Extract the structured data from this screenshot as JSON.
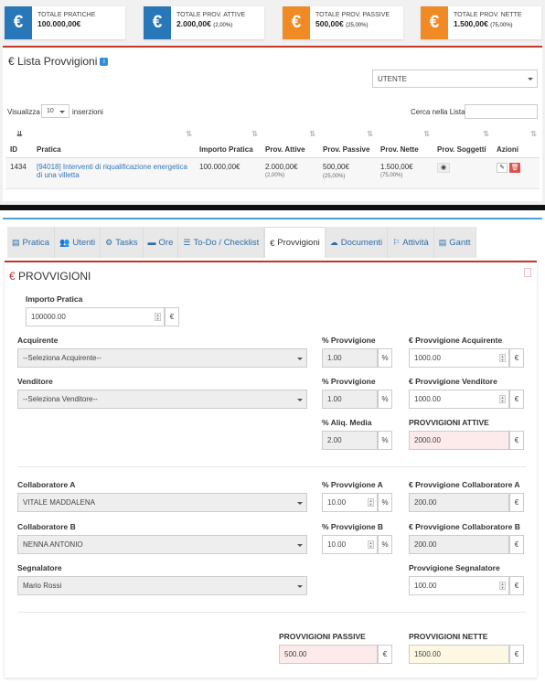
{
  "summary_cards": [
    {
      "label": "TOTALE PRATICHE",
      "value": "100.000,00€",
      "pct": "",
      "color": "#2877b9"
    },
    {
      "label": "TOTALE PROV. ATTIVE",
      "value": "2.000,00€",
      "pct": "(2,00%)",
      "color": "#2877b9"
    },
    {
      "label": "TOTALE PROV. PASSIVE",
      "value": "500,00€",
      "pct": "(25,00%)",
      "color": "#f08a24"
    },
    {
      "label": "TOTALE PROV. NETTE",
      "value": "1.500,00€",
      "pct": "(75,00%)",
      "color": "#f08a24"
    }
  ],
  "card_icon": "€",
  "lista": {
    "title": "Lista Provvigioni",
    "info_icon": "i",
    "user_select": "UTENTE",
    "show_prefix": "Visualizza",
    "show_value": "10",
    "show_suffix": "inserzioni",
    "search_label": "Cerca nella Lista:",
    "columns": [
      "ID",
      "Pratica",
      "Importo Pratica",
      "Prov. Attive",
      "Prov. Passive",
      "Prov. Nette",
      "Prov. Soggetti",
      "Azioni"
    ],
    "rows": [
      {
        "id": "1434",
        "pratica": "[94018] Interventi di riqualificazione energetica di una villetta",
        "importo": "100.000,00€",
        "attive": "2.000,00€",
        "attive_pct": "(2,00%)",
        "passive": "500,00€",
        "passive_pct": "(25,00%)",
        "nette": "1.500,00€",
        "nette_pct": "(75,00%)"
      }
    ]
  },
  "tabs": [
    {
      "label": "Pratica",
      "icon": "▤"
    },
    {
      "label": "Utenti",
      "icon": "👥"
    },
    {
      "label": "Tasks",
      "icon": "⚙"
    },
    {
      "label": "Ore",
      "icon": "▬"
    },
    {
      "label": "To-Do / Checklist",
      "icon": "☰"
    },
    {
      "label": "Provvigioni",
      "icon": "€"
    },
    {
      "label": "Documenti",
      "icon": "☁"
    },
    {
      "label": "Attività",
      "icon": "⚐"
    },
    {
      "label": "Gantt",
      "icon": "▤"
    }
  ],
  "provvigioni": {
    "title": "PROVVIGIONI",
    "importo_label": "Importo Pratica",
    "importo_value": "100000.00",
    "euro": "€",
    "pct": "%",
    "acquirente_label": "Acquirente",
    "acquirente_value": "--Seleziona Acquirente--",
    "pct_prov_label": "% Provvigione",
    "pct_acq_value": "1.00",
    "prov_acq_label": "€ Provvigione Acquirente",
    "prov_acq_value": "1000.00",
    "venditore_label": "Venditore",
    "venditore_value": "--Seleziona Venditore--",
    "pct_vend_value": "1.00",
    "prov_vend_label": "€ Provvigione Venditore",
    "prov_vend_value": "1000.00",
    "aliq_label": "% Aliq. Media",
    "aliq_value": "2.00",
    "attive_label": "PROVVIGIONI ATTIVE",
    "attive_value": "2000.00",
    "collA_label": "Collaboratore A",
    "collA_value": "VITALE MADDALENA",
    "pctA_label": "% Provvigione A",
    "pctA_value": "10.00",
    "provA_label": "€ Provvigione Collaboratore A",
    "provA_value": "200.00",
    "collB_label": "Collaboratore B",
    "collB_value": "NENNA ANTONIO",
    "pctB_label": "% Provvigione B",
    "pctB_value": "10.00",
    "provB_label": "€ Provvigione Collaboratore B",
    "provB_value": "200.00",
    "segn_label": "Segnalatore",
    "segn_value": "Mario Rossi",
    "prov_segn_label": "Provvigione Segnalatore",
    "prov_segn_value": "100.00",
    "passive_label": "PROVVIGIONI PASSIVE",
    "passive_value": "500.00",
    "nette_label": "PROVVIGIONI NETTE",
    "nette_value": "1500.00"
  }
}
